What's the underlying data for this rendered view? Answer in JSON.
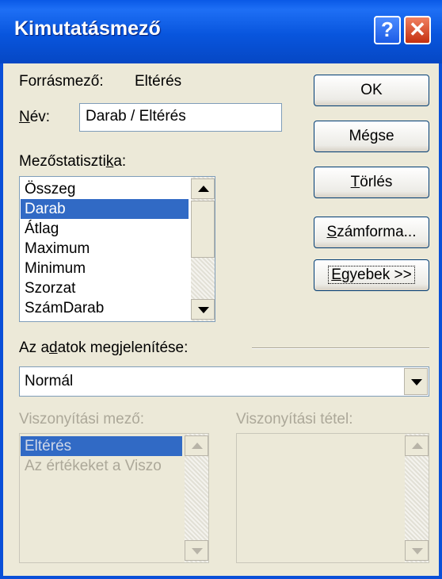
{
  "window": {
    "title": "Kimutatásmező",
    "help_glyph": "?",
    "close_glyph": "✕"
  },
  "source": {
    "label": "Forrásmező:",
    "value": "Eltérés"
  },
  "name": {
    "label_pre": "",
    "label_ul": "N",
    "label_post": "év:",
    "value": "Darab / Eltérés"
  },
  "summary": {
    "label_pre": "Mezőstatiszti",
    "label_ul": "k",
    "label_post": "a:",
    "items": [
      "Összeg",
      "Darab",
      "Átlag",
      "Maximum",
      "Minimum",
      "Szorzat",
      "SzámDarab"
    ],
    "selected": "Darab"
  },
  "buttons": {
    "ok": "OK",
    "cancel": "Mégse",
    "delete": {
      "pre": "",
      "ul": "T",
      "post": "örlés"
    },
    "number_format": {
      "pre": "",
      "ul": "S",
      "post": "zámforma..."
    },
    "more": {
      "pre": "",
      "ul": "E",
      "post": "gyebek >>"
    }
  },
  "show_data": {
    "label_pre": "Az a",
    "label_ul": "d",
    "label_post": "atok megjelenítése:",
    "value": "Normál"
  },
  "base_field": {
    "label": "Viszonyítási mező:",
    "items": [
      "Eltérés",
      "Az értékeket a Viszo"
    ],
    "selected": "Eltérés"
  },
  "base_item": {
    "label": "Viszonyítási tétel:",
    "items": []
  }
}
